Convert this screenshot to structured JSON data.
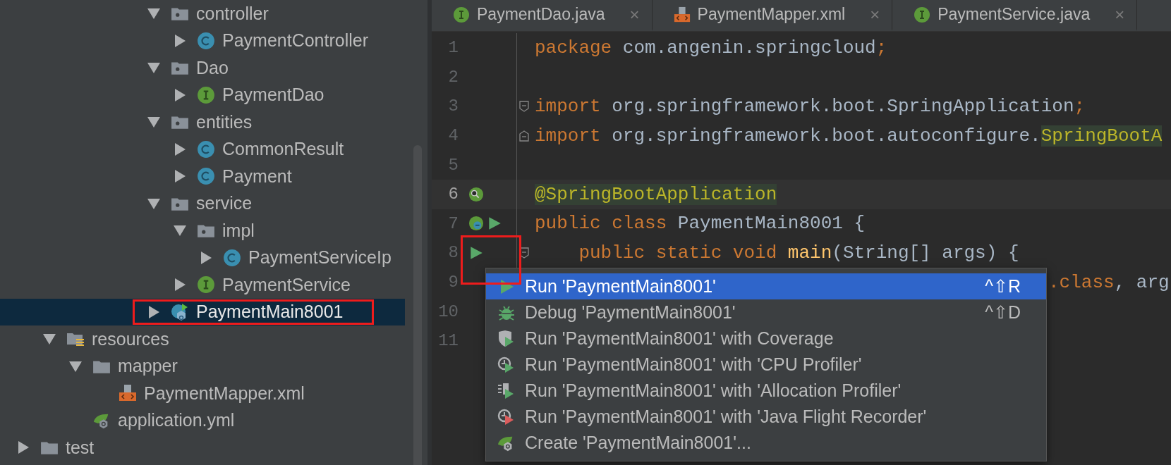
{
  "project_tree": {
    "package_items": [
      {
        "label": "controller",
        "kind": "package",
        "expanded": true,
        "selected": false,
        "children": [
          {
            "label": "PaymentController",
            "kind": "class",
            "expanded": false,
            "selected": false
          }
        ]
      },
      {
        "label": "Dao",
        "kind": "package",
        "expanded": true,
        "selected": false,
        "children": [
          {
            "label": "PaymentDao",
            "kind": "interface",
            "expanded": false,
            "selected": false
          }
        ]
      },
      {
        "label": "entities",
        "kind": "package",
        "expanded": true,
        "selected": false,
        "children": [
          {
            "label": "CommonResult",
            "kind": "class",
            "expanded": false,
            "selected": false
          },
          {
            "label": "Payment",
            "kind": "class",
            "expanded": false,
            "selected": false
          }
        ]
      },
      {
        "label": "service",
        "kind": "package",
        "expanded": true,
        "selected": false,
        "children": [
          {
            "label": "impl",
            "kind": "package",
            "expanded": true,
            "selected": false,
            "children": [
              {
                "label": "PaymentServiceIp",
                "kind": "class",
                "expanded": false,
                "selected": false
              }
            ]
          },
          {
            "label": "PaymentService",
            "kind": "interface",
            "expanded": false,
            "selected": false
          }
        ]
      },
      {
        "label": "PaymentMain8001",
        "kind": "spring_main",
        "expanded": false,
        "selected": true,
        "annotated": true
      }
    ],
    "module_items": [
      {
        "label": "resources",
        "kind": "resources",
        "expanded": true,
        "selected": false,
        "children": [
          {
            "label": "mapper",
            "kind": "folder",
            "expanded": true,
            "selected": false,
            "children": [
              {
                "label": "PaymentMapper.xml",
                "kind": "xml",
                "selected": false
              }
            ]
          },
          {
            "label": "application.yml",
            "kind": "spring_config",
            "selected": false
          }
        ]
      }
    ],
    "root_items": [
      {
        "label": "test",
        "kind": "folder",
        "expanded": false,
        "selected": false
      }
    ]
  },
  "editor": {
    "tabs": [
      {
        "label": "PaymentDao.java",
        "kind": "interface",
        "selected": false,
        "close": "×"
      },
      {
        "label": "PaymentMapper.xml",
        "kind": "xml",
        "selected": false,
        "close": "×"
      },
      {
        "label": "PaymentService.java",
        "kind": "interface",
        "selected": false,
        "close": "×"
      }
    ],
    "lines": [
      {
        "number": "1",
        "current": false,
        "tokens": [
          {
            "text": "package ",
            "kind": "keyword"
          },
          {
            "text": "com.angenin.springcloud",
            "kind": "plain"
          },
          {
            "text": ";",
            "kind": "keyword"
          }
        ]
      },
      {
        "number": "2",
        "current": false
      },
      {
        "number": "3",
        "current": false,
        "fold": {
          "kind": "start"
        },
        "tokens": [
          {
            "text": "import ",
            "kind": "keyword"
          },
          {
            "text": "org.springframework.boot.SpringApplication",
            "kind": "plain"
          },
          {
            "text": ";",
            "kind": "keyword"
          }
        ]
      },
      {
        "number": "4",
        "current": false,
        "fold": {
          "kind": "end"
        },
        "tokens": [
          {
            "text": "import ",
            "kind": "keyword"
          },
          {
            "text": "org.springframework.boot.autoconfigure.",
            "kind": "plain"
          },
          {
            "text": "SpringBootA",
            "kind": "usage"
          }
        ]
      },
      {
        "number": "5",
        "current": false
      },
      {
        "number": "6",
        "current": true,
        "gutter_icons": [
          {
            "kind": "spring_search"
          }
        ],
        "tokens": [
          {
            "text": "@SpringBootApplication",
            "kind": "usage"
          }
        ]
      },
      {
        "number": "7",
        "current": false,
        "gutter_icons": [
          {
            "kind": "spring_bean"
          },
          {
            "kind": "run"
          }
        ],
        "tokens": [
          {
            "text": "public class ",
            "kind": "keyword"
          },
          {
            "text": "PaymentMain8001 {",
            "kind": "plain"
          }
        ]
      },
      {
        "number": "8",
        "current": false,
        "gutter_icons": [
          {
            "kind": "run"
          }
        ],
        "annotated": true,
        "fold": {
          "kind": "start"
        },
        "tokens": [
          {
            "text": "    public static void ",
            "kind": "keyword"
          },
          {
            "text": "main",
            "kind": "method"
          },
          {
            "text": "(String[] args) {",
            "kind": "plain"
          }
        ]
      },
      {
        "number": "9",
        "current": false,
        "covered_by_menu": true,
        "tokens": [
          {
            "text": ".class",
            "kind": "keyword"
          },
          {
            "text": ", arg",
            "kind": "plain"
          }
        ]
      },
      {
        "number": "10",
        "current": false
      },
      {
        "number": "11",
        "current": false
      }
    ],
    "context_menu": [
      {
        "label": "Run 'PaymentMain8001'",
        "kind": "run",
        "shortcut": "^⇧R",
        "selected": true
      },
      {
        "label": "Debug 'PaymentMain8001'",
        "kind": "debug",
        "shortcut": "^⇧D",
        "selected": false
      },
      {
        "label": "Run 'PaymentMain8001' with Coverage",
        "kind": "coverage",
        "selected": false
      },
      {
        "label": "Run 'PaymentMain8001' with 'CPU Profiler'",
        "kind": "cpu_profiler",
        "selected": false
      },
      {
        "label": "Run 'PaymentMain8001' with 'Allocation Profiler'",
        "kind": "allocation_profiler",
        "selected": false
      },
      {
        "label": "Run 'PaymentMain8001' with 'Java Flight Recorder'",
        "kind": "flight_recorder",
        "selected": false
      },
      {
        "label": "Create 'PaymentMain8001'...",
        "kind": "create",
        "selected": false
      }
    ]
  }
}
